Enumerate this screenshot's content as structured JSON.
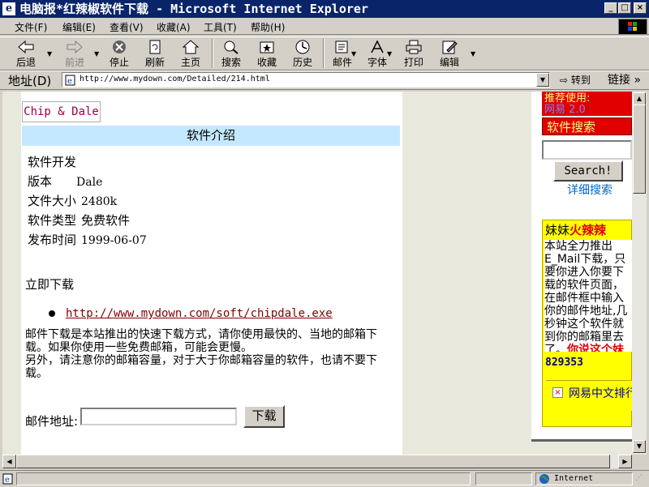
{
  "window": {
    "title": "电脑报*红辣椒软件下载 - Microsoft Internet Explorer",
    "icon": "ie-icon",
    "controls": {
      "minimize": "_",
      "maximize": "□",
      "close": "×"
    }
  },
  "menu": [
    "文件(F)",
    "编辑(E)",
    "查看(V)",
    "收藏(A)",
    "工具(T)",
    "帮助(H)"
  ],
  "toolbar": [
    {
      "label": "后退",
      "icon": "back-arrow-icon",
      "enabled": true
    },
    {
      "label": "前进",
      "icon": "forward-arrow-icon",
      "enabled": false
    },
    {
      "label": "停止",
      "icon": "stop-icon",
      "enabled": true
    },
    {
      "label": "刷新",
      "icon": "refresh-icon",
      "enabled": true
    },
    {
      "label": "主页",
      "icon": "home-icon",
      "enabled": true
    },
    {
      "label": "搜索",
      "icon": "search-icon",
      "enabled": true
    },
    {
      "label": "收藏",
      "icon": "favorites-icon",
      "enabled": true
    },
    {
      "label": "历史",
      "icon": "history-icon",
      "enabled": true
    },
    {
      "label": "邮件",
      "icon": "mail-icon",
      "enabled": true
    },
    {
      "label": "字体",
      "icon": "font-icon",
      "enabled": true
    },
    {
      "label": "打印",
      "icon": "print-icon",
      "enabled": true
    },
    {
      "label": "编辑",
      "icon": "edit-icon",
      "enabled": true
    }
  ],
  "address": {
    "label": "地址(D)",
    "url": "http://www.mydown.com/Detailed/214.html",
    "go": "转到",
    "links": "链接 »"
  },
  "page": {
    "software_name": "Chip & Dale",
    "section_title": "软件介绍",
    "info": [
      {
        "label": "软件开发",
        "value": ""
      },
      {
        "label": "版本",
        "value": "Dale"
      },
      {
        "label": "文件大小",
        "value": "2480k"
      },
      {
        "label": "软件类型",
        "value": "免费软件"
      },
      {
        "label": "发布时间",
        "value": "1999-06-07"
      }
    ],
    "download_title": "立即下载",
    "download_link": "http://www.mydown.com/soft/chipdale.exe",
    "download_desc": "邮件下载是本站推出的快速下载方式，请你使用最快的、当地的邮箱下载。如果你使用一些免费邮箱，可能会更慢。",
    "download_note": "另外，请注意你的邮箱容量，对于大于你邮箱容量的软件，也请不要下载。",
    "email_label": "邮件地址:",
    "email_value": "",
    "download_button": "下载"
  },
  "sidebar": {
    "top_line1": "推荐使用:",
    "top_line2": "网易 2.0",
    "search_tab": "软件搜索",
    "search_value": "",
    "search_button": "Search!",
    "advanced_search": "详细搜索",
    "promo_title_plain": "妹妹",
    "promo_title_hot": "火辣辣",
    "promo_text": "本站全力推出E_Mail下载，只要你进入你要下载的软件页面，在邮件框中输入你的邮件地址,几秒钟这个软件就到你的邮箱里去了。",
    "promo_emphasis": "你说这个妹妹辣不辣",
    "code": "829353",
    "netease_text": "网易中文排行榜"
  },
  "status": {
    "zone": "Internet"
  },
  "colors": {
    "titlebar": "#0a246a",
    "sidebar_red": "#e00000",
    "promo_yellow": "#ffff00",
    "link": "#800000",
    "intro_bar": "#c4e8ff"
  }
}
